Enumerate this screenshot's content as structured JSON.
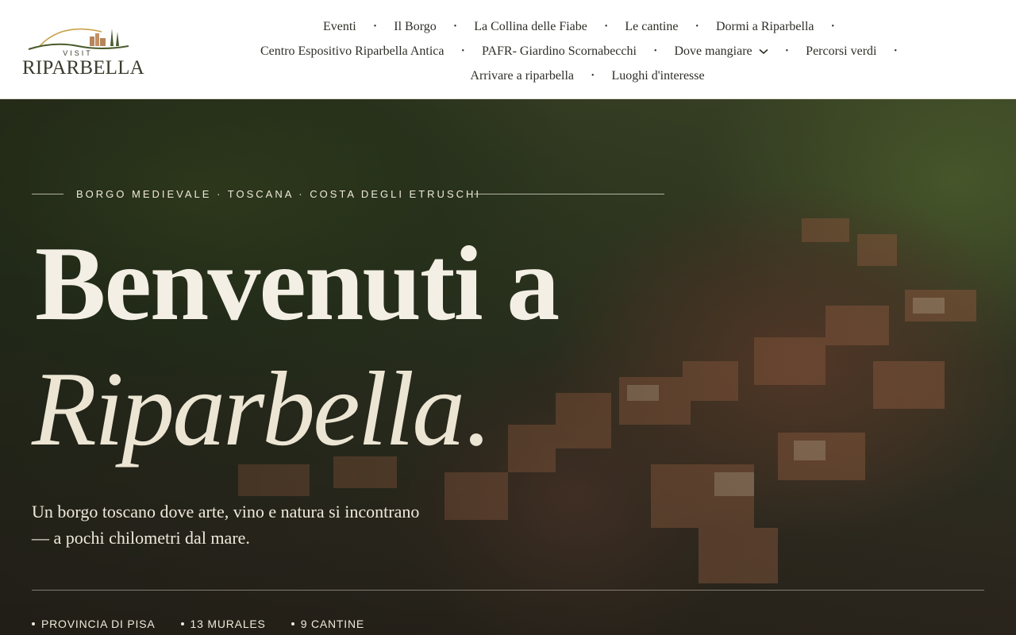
{
  "header": {
    "logo": {
      "visit": "VISIT",
      "brand": "RIPARBELLA",
      "icon": "hill-town-logo-icon"
    },
    "nav_rows": [
      [
        "Eventi",
        "Il Borgo",
        "La Collina delle Fiabe",
        "Le cantine",
        "Dormi a Riparbella"
      ],
      [
        "Centro Espositivo Riparbella Antica",
        "PAFR- Giardino Scornabecchi",
        "Dove mangiare",
        "Percorsi verdi"
      ],
      [
        "Arrivare a riparbella",
        "Luoghi d'interesse"
      ]
    ],
    "nav_separator": "•",
    "dropdown_icon": "chevron-down-icon"
  },
  "hero": {
    "tagline": "BORGO MEDIEVALE · TOSCANA · COSTA DEGLI ETRUSCHI",
    "title_line1": "Benvenuti a",
    "title_line2": "Riparbella",
    "title_dot": ".",
    "subtitle_line1": "Un borgo toscano dove arte, vino e natura si incontrano",
    "subtitle_line2": "— a pochi chilometri dal mare.",
    "stats": [
      "PROVINCIA DI PISA",
      "13 MURALES",
      "9 CANTINE"
    ]
  },
  "colors": {
    "brand": "#3b3b2e",
    "hero_text": "#efe9dc",
    "logo_accent": "#c9a24a"
  }
}
